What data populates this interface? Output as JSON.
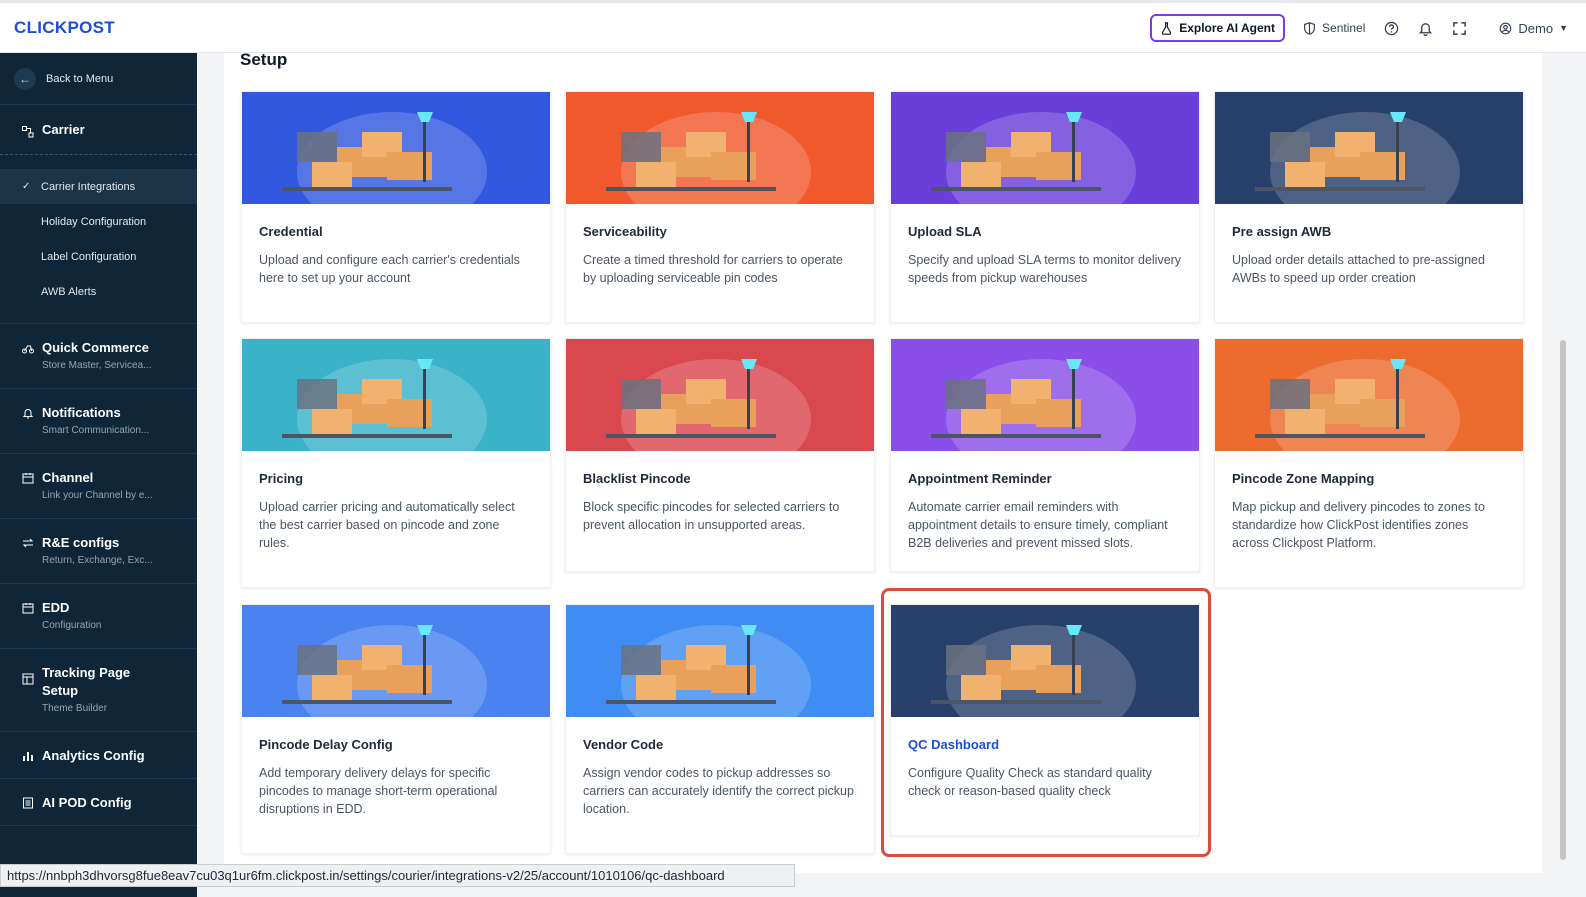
{
  "header": {
    "logo": "CLICKPOST",
    "ai_agent_label": "Explore AI Agent",
    "sentinel_label": "Sentinel",
    "user_label": "Demo"
  },
  "sidebar": {
    "back_label": "Back to Menu",
    "carrier_label": "Carrier",
    "carrier_items": [
      {
        "label": "Carrier Integrations"
      },
      {
        "label": "Holiday Configuration"
      },
      {
        "label": "Label Configuration"
      },
      {
        "label": "AWB Alerts"
      }
    ],
    "sections": [
      {
        "title": "Quick Commerce",
        "subtitle": "Store Master, Servicea..."
      },
      {
        "title": "Notifications",
        "subtitle": "Smart Communication..."
      },
      {
        "title": "Channel",
        "subtitle": "Link your Channel by e..."
      },
      {
        "title": "R&E configs",
        "subtitle": "Return, Exchange, Exc..."
      },
      {
        "title": "EDD",
        "subtitle": "Configuration"
      },
      {
        "title": "Tracking Page Setup",
        "subtitle": "Theme Builder"
      },
      {
        "title": "Analytics Config",
        "subtitle": ""
      },
      {
        "title": "AI POD Config",
        "subtitle": ""
      }
    ]
  },
  "main": {
    "title": "Setup",
    "cards": [
      {
        "title": "Credential",
        "desc": "Upload and configure each carrier's credentials here to set up your account",
        "color": "#3358e0"
      },
      {
        "title": "Serviceability",
        "desc": "Create a timed threshold for carriers to operate by uploading serviceable pin codes",
        "color": "#f0592c"
      },
      {
        "title": "Upload SLA",
        "desc": "Specify and upload SLA terms to monitor delivery speeds from pickup warehouses",
        "color": "#6a3fd9"
      },
      {
        "title": "Pre assign AWB",
        "desc": "Upload order details attached to pre-assigned AWBs to speed up order creation",
        "color": "#27406b"
      },
      {
        "title": "Pricing",
        "desc": "Upload carrier pricing and automatically select the best carrier based on pincode and zone rules.",
        "color": "#3ab3c9"
      },
      {
        "title": "Blacklist Pincode",
        "desc": "Block specific pincodes for selected carriers to prevent allocation in unsupported areas.",
        "color": "#d9474f"
      },
      {
        "title": "Appointment Reminder",
        "desc": "Automate carrier email reminders with appointment details to ensure timely, compliant B2B deliveries and prevent missed slots.",
        "color": "#8a4fe8"
      },
      {
        "title": "Pincode Zone Mapping",
        "desc": "Map pickup and delivery pincodes to zones to standardize how ClickPost identifies zones across Clickpost Platform.",
        "color": "#ec6b2d"
      },
      {
        "title": "Pincode Delay Config",
        "desc": "Add temporary delivery delays for specific pincodes to manage short-term operational disruptions in EDD.",
        "color": "#4a82ef"
      },
      {
        "title": "Vendor Code",
        "desc": "Assign vendor codes to pickup addresses so carriers can accurately identify the correct pickup location.",
        "color": "#3f8df3"
      },
      {
        "title": "QC Dashboard",
        "desc": "Configure Quality Check as standard quality check or reason-based quality check",
        "color": "#27406b"
      }
    ]
  },
  "statusbar": {
    "url": "https://nnbph3dhvorsg8fue8eav7cu03q1ur6fm.clickpost.in/settings/courier/integrations-v2/25/account/1010106/qc-dashboard"
  }
}
